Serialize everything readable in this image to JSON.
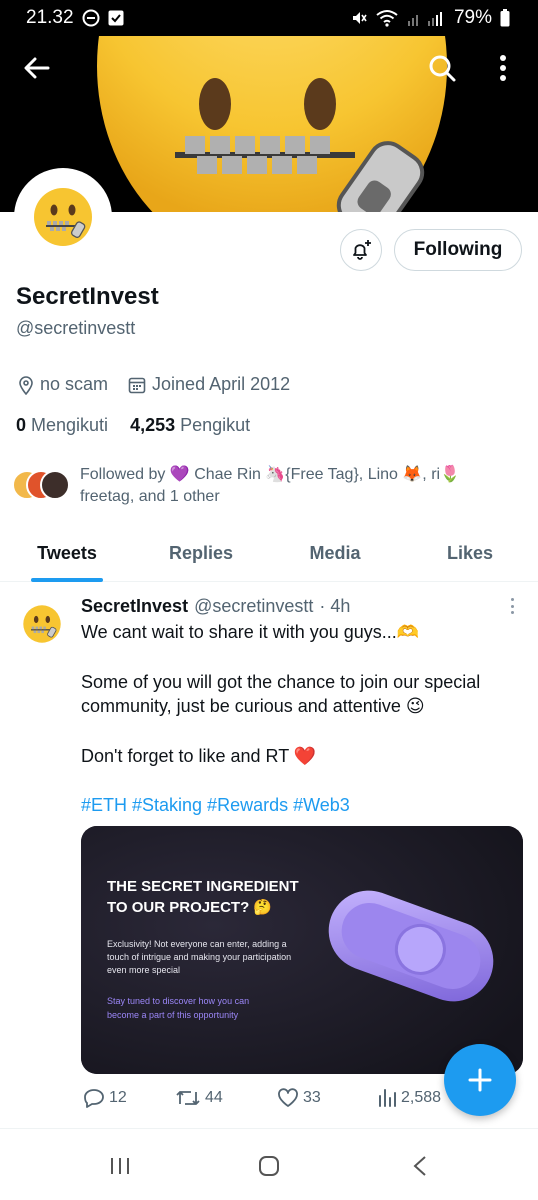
{
  "status_bar": {
    "time": "21.32",
    "battery": "79%",
    "icons": [
      "dnd-icon",
      "notification-check-icon",
      "mute-icon",
      "wifi-icon",
      "signal-icon",
      "battery-icon"
    ]
  },
  "header": {
    "back_icon": "back-arrow-icon",
    "search_icon": "search-icon",
    "more_icon": "more-vertical-icon"
  },
  "profile": {
    "name": "SecretInvest",
    "handle": "@secretinvestt",
    "location": "no scam",
    "joined": "Joined April 2012",
    "following_count": "0",
    "following_label": "Mengikuti",
    "followers_count": "4,253",
    "followers_label": "Pengikut",
    "followed_by": "Followed by 💜 Chae Rin 🦄{Free Tag}, Lino 🦊, ri🌷 freetag, and 1 other",
    "follow_button": "Following"
  },
  "tabs": [
    {
      "label": "Tweets",
      "active": true
    },
    {
      "label": "Replies",
      "active": false
    },
    {
      "label": "Media",
      "active": false
    },
    {
      "label": "Likes",
      "active": false
    }
  ],
  "tweet": {
    "name": "SecretInvest",
    "handle": "@secretinvestt",
    "time": "· 4h",
    "line1": "We cant wait to share it with you guys...🫶",
    "line2": "Some of you will got the chance to join our special",
    "line3": "community, just be curious and attentive 😉",
    "line4": "Don't forget to like and RT ❤️",
    "hashtags": "#ETH #Staking #Rewards #Web3",
    "media": {
      "title_line1": "THE SECRET INGREDIENT",
      "title_line2": "TO OUR PROJECT? 🤔",
      "body": "Exclusivity! Not everyone can enter, adding a touch of intrigue and making your participation even more special",
      "cta": "Stay tuned to discover how you can become a part of this opportunity"
    },
    "replies": "12",
    "retweets": "44",
    "likes": "33",
    "views": "2,588"
  },
  "colors": {
    "accent": "#1d9bf0",
    "text": "#0f1419",
    "secondary": "#536471"
  }
}
